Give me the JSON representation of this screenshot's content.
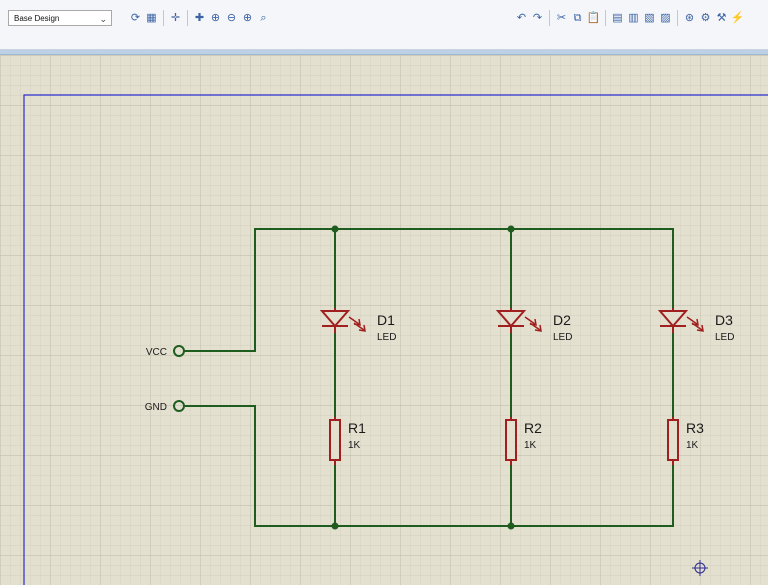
{
  "toolbar": {
    "design_select_value": "Base Design",
    "left_tools": [
      {
        "name": "refresh-icon",
        "glyph": "⟳"
      },
      {
        "name": "grid-toggle-icon",
        "glyph": "▦"
      },
      {
        "name": "origin-icon",
        "glyph": "✛"
      },
      {
        "name": "pan-icon",
        "glyph": "✚"
      },
      {
        "name": "zoom-in-icon",
        "glyph": "⊕"
      },
      {
        "name": "zoom-out-icon",
        "glyph": "⊖"
      },
      {
        "name": "zoom-all-icon",
        "glyph": "⊕"
      },
      {
        "name": "zoom-area-icon",
        "glyph": "⌕"
      }
    ],
    "right_tools": [
      {
        "name": "undo-icon",
        "glyph": "↶"
      },
      {
        "name": "redo-icon",
        "glyph": "↷"
      },
      {
        "name": "cut-icon",
        "glyph": "✂"
      },
      {
        "name": "copy-icon",
        "glyph": "⧉"
      },
      {
        "name": "paste-icon",
        "glyph": "📋"
      },
      {
        "name": "block-copy-icon",
        "glyph": "▤"
      },
      {
        "name": "block-move-icon",
        "glyph": "▥"
      },
      {
        "name": "block-rotate-icon",
        "glyph": "▧"
      },
      {
        "name": "block-delete-icon",
        "glyph": "▨"
      },
      {
        "name": "pick-device-icon",
        "glyph": "⊛"
      },
      {
        "name": "make-device-icon",
        "glyph": "⚙"
      },
      {
        "name": "package-tool-icon",
        "glyph": "⚒"
      },
      {
        "name": "decompose-icon",
        "glyph": "⚡"
      }
    ]
  },
  "schematic": {
    "colors": {
      "wire": "#1f5c1f",
      "component": "#a02020",
      "text": "#1a1a1a",
      "sheet_border": "#2c2ccf",
      "grid": "#cfccbb",
      "grid_major": "#bdb9a5",
      "background": "#e3e0cf"
    },
    "terminals": [
      {
        "label": "VCC"
      },
      {
        "label": "GND"
      }
    ],
    "leds": [
      {
        "ref": "D1",
        "value": "LED"
      },
      {
        "ref": "D2",
        "value": "LED"
      },
      {
        "ref": "D3",
        "value": "LED"
      }
    ],
    "resistors": [
      {
        "ref": "R1",
        "value": "1K"
      },
      {
        "ref": "R2",
        "value": "1K"
      },
      {
        "ref": "R3",
        "value": "1K"
      }
    ]
  }
}
